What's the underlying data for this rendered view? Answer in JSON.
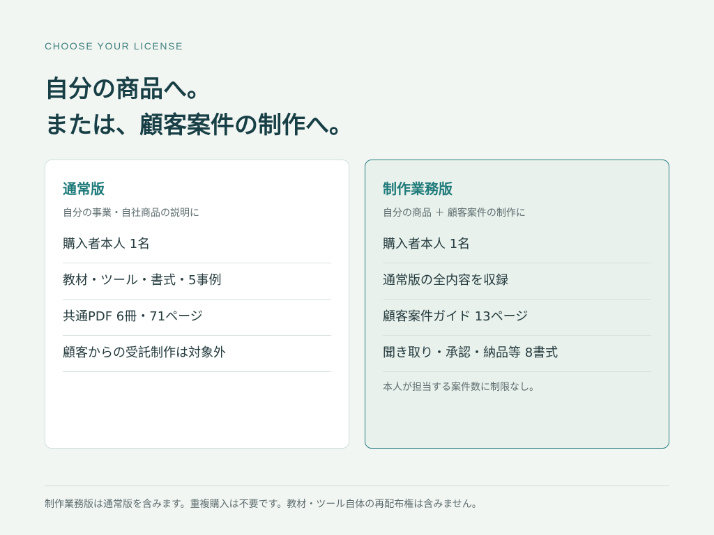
{
  "eyebrow": "CHOOSE YOUR LICENSE",
  "headline": {
    "line1": "自分の商品へ。",
    "line2": "または、顧客案件の制作へ。"
  },
  "standard": {
    "title": "通常版",
    "subtitle": "自分の事業・自社商品の説明に",
    "features": [
      "購入者本人 1名",
      "教材・ツール・書式・5事例",
      "共通PDF 6冊・71ページ",
      "顧客からの受託制作は対象外"
    ]
  },
  "pro": {
    "title": "制作業務版",
    "subtitle": "自分の商品 ＋ 顧客案件の制作に",
    "features": [
      "購入者本人 1名",
      "通常版の全内容を収録",
      "顧客案件ガイド 13ページ",
      "聞き取り・承認・納品等 8書式"
    ],
    "note": "本人が担当する案件数に制限なし。"
  },
  "footer": {
    "note": "制作業務版は通常版を含みます。重複購入は不要です。教材・ツール自体の再配布権は含みません。"
  },
  "colors": {
    "background": "#f2f6f3",
    "accent": "#1f7a7a",
    "pro_card_bg": "#e8f1ec",
    "pro_card_border": "#2b7f83"
  }
}
